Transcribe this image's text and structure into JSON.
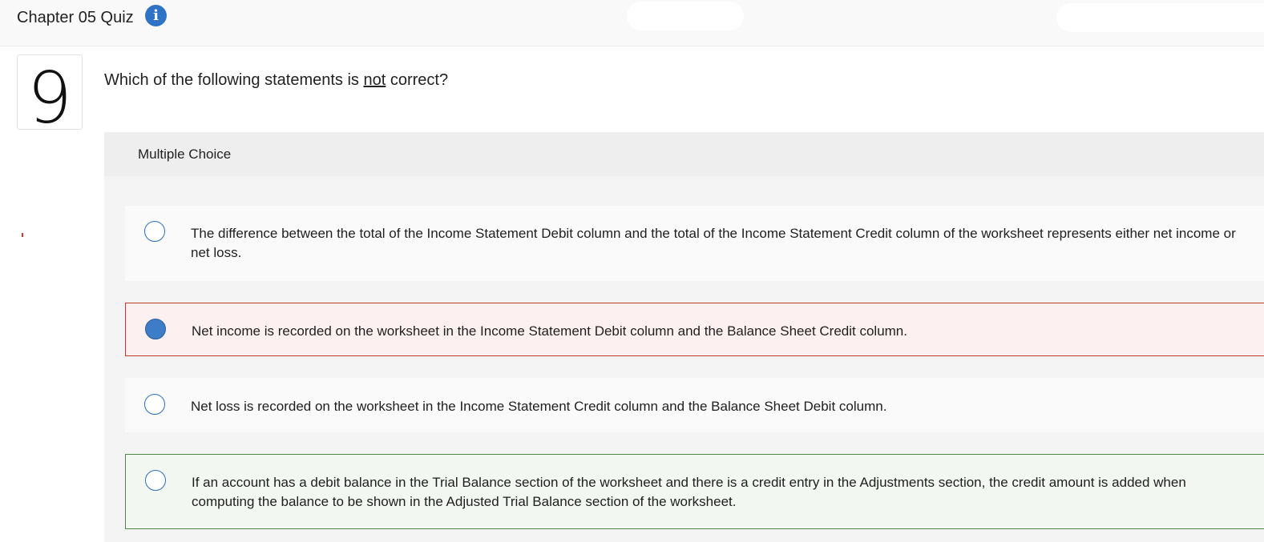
{
  "header": {
    "quiz_title": "Chapter 05 Quiz",
    "info_icon": "info-icon"
  },
  "question": {
    "number": "9",
    "text_before": "Which of the following statements is ",
    "text_emphasis": "not",
    "text_after": " correct?",
    "type_label": "Multiple Choice"
  },
  "options": [
    {
      "text": "The difference between the total of the Income Statement Debit column and the total of the Income Statement Credit column of the worksheet represents either net income or net loss.",
      "selected": false,
      "status": "default"
    },
    {
      "text": "Net income is recorded on the worksheet in the Income Statement Debit column and the Balance Sheet Credit column.",
      "selected": true,
      "status": "incorrect"
    },
    {
      "text": "Net loss is recorded on the worksheet in the Income Statement Credit column and the Balance Sheet Debit column.",
      "selected": false,
      "status": "default"
    },
    {
      "text": "If an account has a debit balance in the Trial Balance section of the worksheet and there is a credit entry in the Adjustments section, the credit amount is added when computing the balance to be shown in the Adjusted Trial Balance section of the worksheet.",
      "selected": false,
      "status": "correct"
    }
  ],
  "colors": {
    "accent": "#2f73c6",
    "incorrect_border": "#c0392b",
    "incorrect_bg": "#fdf0f0",
    "correct_border": "#4b8a45",
    "correct_bg": "#f2f7f1"
  }
}
